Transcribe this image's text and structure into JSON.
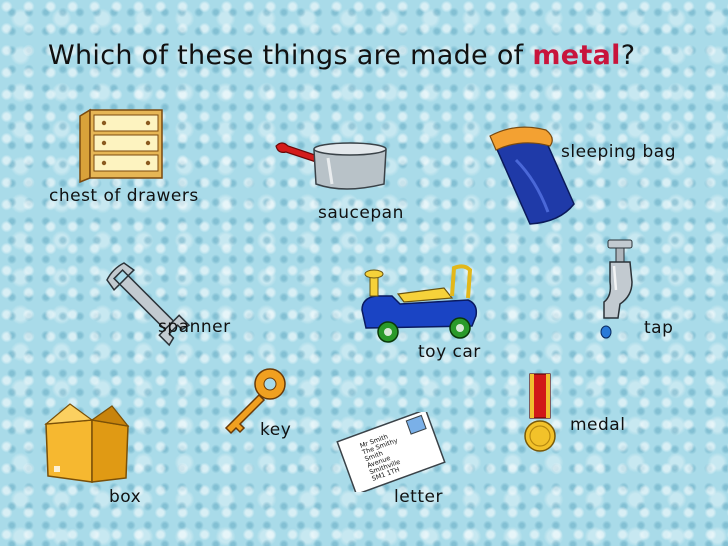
{
  "question": {
    "prefix": "Which of these things are made of ",
    "highlight": "metal",
    "suffix": "?"
  },
  "items": {
    "chest_of_drawers": "chest of drawers",
    "saucepan": "saucepan",
    "sleeping_bag": "sleeping bag",
    "spanner": "spanner",
    "toy_car": "toy car",
    "tap": "tap",
    "key": "key",
    "medal": "medal",
    "box": "box",
    "letter": "letter"
  },
  "letter_address": [
    "Mr Smith",
    "The Smithy",
    "Smith",
    "Avenue",
    "Smithville",
    "SM1 1TH"
  ],
  "colors": {
    "highlight": "#c8143c",
    "background": "#a9dbe9"
  }
}
